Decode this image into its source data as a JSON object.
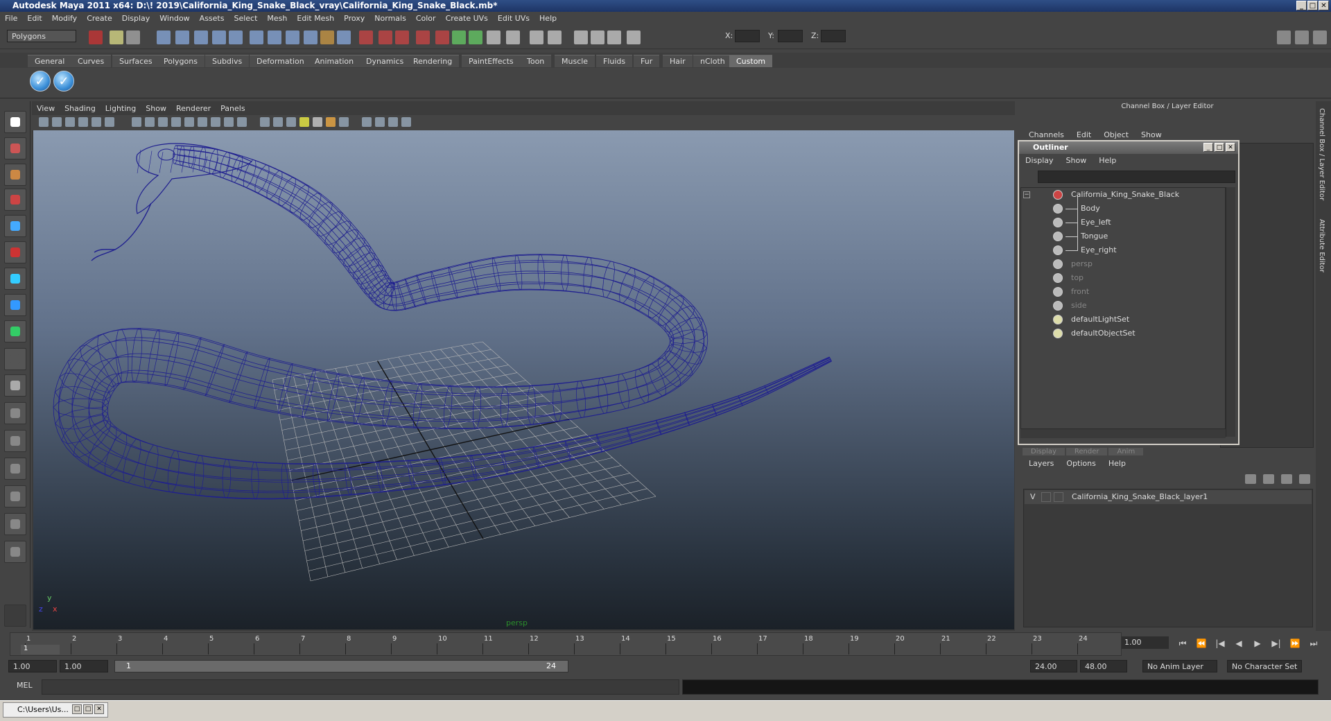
{
  "window": {
    "title": "Autodesk Maya 2011 x64: D:\\! 2019\\California_King_Snake_Black_vray\\California_King_Snake_Black.mb*",
    "min_label": "_",
    "max_label": "□",
    "close_label": "✕"
  },
  "menubar": [
    "File",
    "Edit",
    "Modify",
    "Create",
    "Display",
    "Window",
    "Assets",
    "Select",
    "Mesh",
    "Edit Mesh",
    "Proxy",
    "Normals",
    "Color",
    "Create UVs",
    "Edit UVs",
    "Help"
  ],
  "statusline": {
    "mode": "Polygons",
    "x_label": "X:",
    "y_label": "Y:",
    "z_label": "Z:"
  },
  "shelf_tabs": [
    "General",
    "Curves",
    "Surfaces",
    "Polygons",
    "Subdivs",
    "Deformation",
    "Animation",
    "Dynamics",
    "Rendering",
    "PaintEffects",
    "Toon",
    "Muscle",
    "Fluids",
    "Fur",
    "Hair",
    "nCloth",
    "Custom"
  ],
  "shelf_icons": [
    "checkmark-icon",
    "checkmark-icon"
  ],
  "shelf_icon_glyph": "✓",
  "viewport": {
    "menu": [
      "View",
      "Shading",
      "Lighting",
      "Show",
      "Renderer",
      "Panels"
    ],
    "camera_label": "persp",
    "axis_y": "y",
    "axis_x": "x",
    "axis_z": "z",
    "wire_color": "#1f1f8f",
    "grid_color": "#b8b8b8"
  },
  "channel_box": {
    "header": "Channel Box / Layer Editor",
    "menu": [
      "Channels",
      "Edit",
      "Object",
      "Show"
    ]
  },
  "outliner": {
    "title": "Outliner",
    "menu": [
      "Display",
      "Show",
      "Help"
    ],
    "items": [
      {
        "label": "California_King_Snake_Black",
        "indent": 0,
        "dim": false,
        "icon": "transform-icon"
      },
      {
        "label": "Body",
        "indent": 1,
        "dim": false,
        "icon": "mesh-icon"
      },
      {
        "label": "Eye_left",
        "indent": 1,
        "dim": false,
        "icon": "mesh-icon"
      },
      {
        "label": "Tongue",
        "indent": 1,
        "dim": false,
        "icon": "mesh-icon"
      },
      {
        "label": "Eye_right",
        "indent": 1,
        "dim": false,
        "icon": "mesh-icon"
      },
      {
        "label": "persp",
        "indent": 0,
        "dim": true,
        "icon": "camera-icon"
      },
      {
        "label": "top",
        "indent": 0,
        "dim": true,
        "icon": "camera-icon"
      },
      {
        "label": "front",
        "indent": 0,
        "dim": true,
        "icon": "camera-icon"
      },
      {
        "label": "side",
        "indent": 0,
        "dim": true,
        "icon": "camera-icon"
      },
      {
        "label": "defaultLightSet",
        "indent": 0,
        "dim": false,
        "icon": "set-icon"
      },
      {
        "label": "defaultObjectSet",
        "indent": 0,
        "dim": false,
        "icon": "set-icon"
      }
    ],
    "collapse_glyph": "−"
  },
  "layer_editor": {
    "tabs": [
      "Display",
      "Render",
      "Anim"
    ],
    "menu": [
      "Layers",
      "Options",
      "Help"
    ],
    "layer_visible": "V",
    "layer_name": "California_King_Snake_Black_layer1"
  },
  "side_tabs": [
    "Channel Box / Layer Editor",
    "Attribute Editor"
  ],
  "timeslider": {
    "frames": [
      "1",
      "2",
      "3",
      "4",
      "5",
      "6",
      "7",
      "8",
      "9",
      "10",
      "11",
      "12",
      "13",
      "14",
      "15",
      "16",
      "17",
      "18",
      "19",
      "20",
      "21",
      "22",
      "23",
      "24"
    ],
    "current_frame": "1",
    "current_field": "1.00"
  },
  "playback": [
    "⏮",
    "⏪",
    "|◀",
    "◀",
    "▶",
    "▶|",
    "⏩",
    "⏭"
  ],
  "range": {
    "start": "1.00",
    "playback_start": "1.00",
    "bar_start": "1",
    "bar_end": "24",
    "playback_end": "24.00",
    "end": "48.00",
    "anim_layer": "No Anim Layer",
    "character_set": "No Character Set"
  },
  "cmdline": {
    "label": "MEL"
  },
  "taskbar": {
    "item": "C:\\Users\\Us..."
  }
}
